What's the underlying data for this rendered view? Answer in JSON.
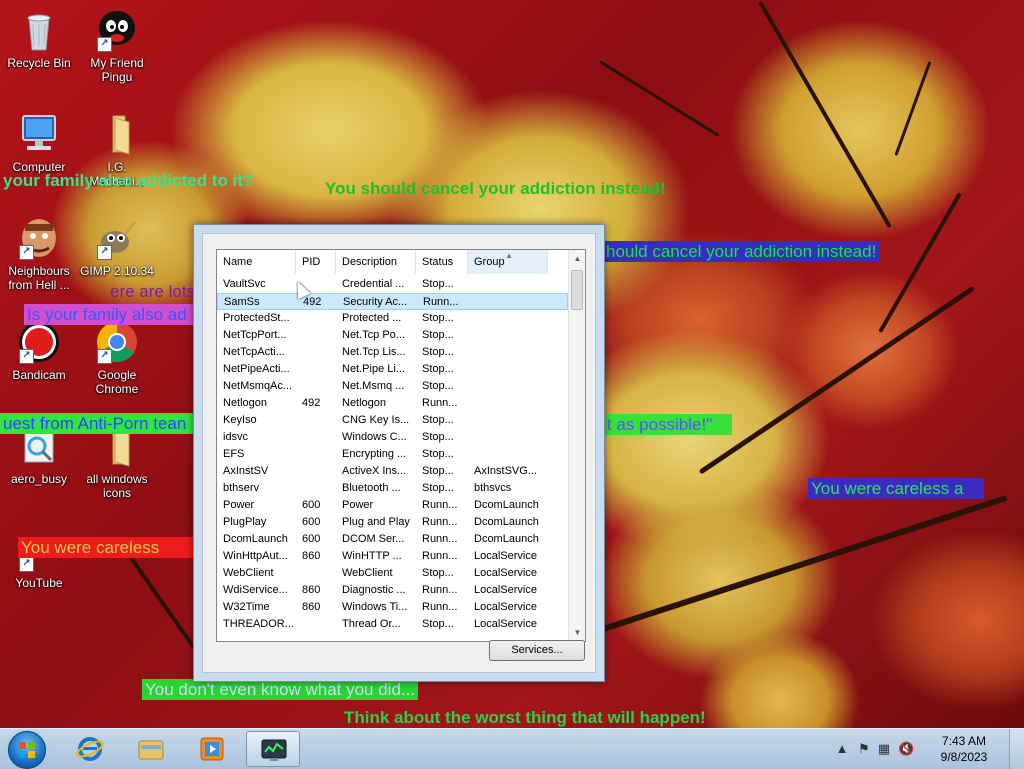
{
  "desktop_icons": [
    {
      "id": "recycle-bin",
      "label": "Recycle Bin",
      "icon": "recycle-bin-icon"
    },
    {
      "id": "my-friend-pingu",
      "label": "My Friend Pingu",
      "icon": "pingu-icon"
    },
    {
      "id": "computer",
      "label": "Computer",
      "icon": "computer-icon"
    },
    {
      "id": "igi-mechanic",
      "label": "I.G. Mechani...",
      "icon": "folder-icon"
    },
    {
      "id": "neighbours",
      "label": "Neighbours from Hell ...",
      "icon": "neighbour-game-icon"
    },
    {
      "id": "gimp",
      "label": "GIMP 2.10.34",
      "icon": "gimp-icon"
    },
    {
      "id": "bandicam",
      "label": "Bandicam",
      "icon": "bandicam-icon"
    },
    {
      "id": "google-chrome",
      "label": "Google Chrome",
      "icon": "chrome-icon"
    },
    {
      "id": "aero-busy",
      "label": "aero_busy",
      "icon": "busy-cursor-icon"
    },
    {
      "id": "all-windows-icons",
      "label": "all windows icons",
      "icon": "folder-icon"
    },
    {
      "id": "youtube",
      "label": "YouTube",
      "icon": "youtube-icon"
    }
  ],
  "banners": [
    {
      "text": "You should cancel your addiction instead!",
      "color": "#1fbf2a",
      "bg": "transparent"
    },
    {
      "text": "your family also addicted to it?",
      "color": "#3de08b",
      "bg": "transparent"
    },
    {
      "text": "hould cancel your addiction instead!",
      "color": "#1ee04a",
      "bg": "#3a2cc0"
    },
    {
      "text": "ere are lots",
      "color": "#7a1fa0",
      "bg": "transparent"
    },
    {
      "text": "Is your family also ad",
      "color": "#3a58ff",
      "bg": "#cf4fd0"
    },
    {
      "text": "uest from Anti-Porn tean",
      "color": "#3040ff",
      "bg": "#2fe640"
    },
    {
      "text": "t as possible!\"",
      "color": "#5a50ff",
      "bg": "#35e13a"
    },
    {
      "text": "You were careless a",
      "color": "#2fe05a",
      "bg": "#3a2cc0"
    },
    {
      "text": "You were careless",
      "color": "#d9c84c",
      "bg": "#ee1c1c"
    },
    {
      "text": "You don't even know what you did...",
      "color": "#d8d8ff",
      "bg": "#27d631"
    },
    {
      "text": "Think about the worst thing that will happen!",
      "color": "#2bd04a",
      "bg": "transparent"
    }
  ],
  "services": {
    "columns": [
      "Name",
      "PID",
      "Description",
      "Status",
      "Group"
    ],
    "sorted_column": "Group",
    "rows": [
      {
        "name": "VaultSvc",
        "pid": "",
        "desc": "Credential ...",
        "status": "Stop...",
        "group": ""
      },
      {
        "name": "SamSs",
        "pid": "492",
        "desc": "Security Ac...",
        "status": "Runn...",
        "group": "",
        "selected": true
      },
      {
        "name": "ProtectedSt...",
        "pid": "",
        "desc": "Protected ...",
        "status": "Stop...",
        "group": ""
      },
      {
        "name": "NetTcpPort...",
        "pid": "",
        "desc": "Net.Tcp Po...",
        "status": "Stop...",
        "group": ""
      },
      {
        "name": "NetTcpActi...",
        "pid": "",
        "desc": "Net.Tcp Lis...",
        "status": "Stop...",
        "group": ""
      },
      {
        "name": "NetPipeActi...",
        "pid": "",
        "desc": "Net.Pipe Li...",
        "status": "Stop...",
        "group": ""
      },
      {
        "name": "NetMsmqAc...",
        "pid": "",
        "desc": "Net.Msmq ...",
        "status": "Stop...",
        "group": ""
      },
      {
        "name": "Netlogon",
        "pid": "492",
        "desc": "Netlogon",
        "status": "Runn...",
        "group": ""
      },
      {
        "name": "KeyIso",
        "pid": "",
        "desc": "CNG Key Is...",
        "status": "Stop...",
        "group": ""
      },
      {
        "name": "idsvc",
        "pid": "",
        "desc": "Windows C...",
        "status": "Stop...",
        "group": ""
      },
      {
        "name": "EFS",
        "pid": "",
        "desc": "Encrypting ...",
        "status": "Stop...",
        "group": ""
      },
      {
        "name": "AxInstSV",
        "pid": "",
        "desc": "ActiveX Ins...",
        "status": "Stop...",
        "group": "AxInstSVG..."
      },
      {
        "name": "bthserv",
        "pid": "",
        "desc": "Bluetooth ...",
        "status": "Stop...",
        "group": "bthsvcs"
      },
      {
        "name": "Power",
        "pid": "600",
        "desc": "Power",
        "status": "Runn...",
        "group": "DcomLaunch"
      },
      {
        "name": "PlugPlay",
        "pid": "600",
        "desc": "Plug and Play",
        "status": "Runn...",
        "group": "DcomLaunch"
      },
      {
        "name": "DcomLaunch",
        "pid": "600",
        "desc": "DCOM Ser...",
        "status": "Runn...",
        "group": "DcomLaunch"
      },
      {
        "name": "WinHttpAut...",
        "pid": "860",
        "desc": "WinHTTP ...",
        "status": "Runn...",
        "group": "LocalService"
      },
      {
        "name": "WebClient",
        "pid": "",
        "desc": "WebClient",
        "status": "Stop...",
        "group": "LocalService"
      },
      {
        "name": "WdiService...",
        "pid": "860",
        "desc": "Diagnostic ...",
        "status": "Runn...",
        "group": "LocalService"
      },
      {
        "name": "W32Time",
        "pid": "860",
        "desc": "Windows Ti...",
        "status": "Runn...",
        "group": "LocalService"
      },
      {
        "name": "THREADOR...",
        "pid": "",
        "desc": "Thread Or...",
        "status": "Stop...",
        "group": "LocalService"
      }
    ],
    "services_button": "Services..."
  },
  "taskbar": {
    "pinned": [
      {
        "id": "internet-explorer",
        "icon": "internet-explorer-icon"
      },
      {
        "id": "windows-explorer",
        "icon": "folder-icon"
      },
      {
        "id": "media-player",
        "icon": "media-player-icon"
      },
      {
        "id": "task-manager",
        "icon": "task-manager-icon",
        "active": true
      }
    ],
    "tray_icons": [
      "show-hidden-icons-arrow",
      "action-center-flag-icon",
      "network-icon",
      "volume-muted-icon"
    ],
    "clock_time": "7:43 AM",
    "clock_date": "9/8/2023"
  }
}
